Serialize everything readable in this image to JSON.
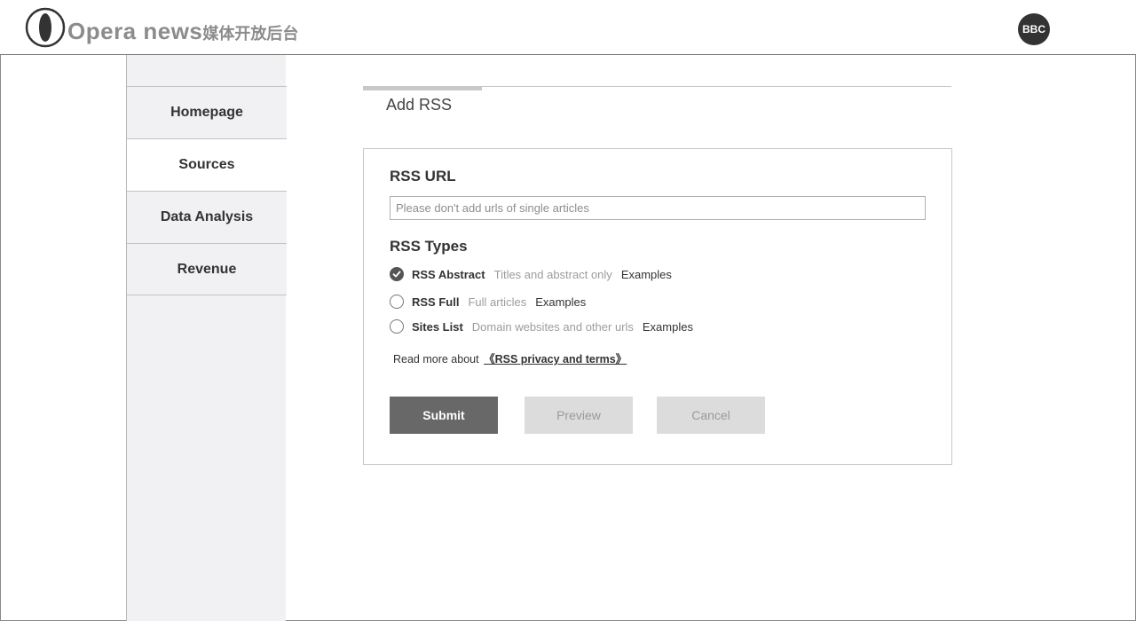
{
  "header": {
    "brand_name": "Opera news",
    "brand_suffix": "媒体开放后台",
    "avatar_label": "BBC"
  },
  "sidebar": {
    "items": [
      {
        "label": "Homepage",
        "active": false
      },
      {
        "label": "Sources",
        "active": true
      },
      {
        "label": "Data Analysis",
        "active": false
      },
      {
        "label": "Revenue",
        "active": false
      }
    ]
  },
  "tabs": [
    {
      "label": "Add RSS",
      "active": true
    }
  ],
  "form": {
    "url_title": "RSS URL",
    "url_placeholder": "Please don't add urls of single articles",
    "url_value": "",
    "types_title": "RSS Types",
    "types": [
      {
        "label": "RSS Abstract",
        "description": "Titles and abstract only",
        "link": "Examples",
        "selected": true
      },
      {
        "label": "RSS Full",
        "description": "Full articles",
        "link": "Examples",
        "selected": false
      },
      {
        "label": "Sites List",
        "description": "Domain websites and other urls",
        "link": "Examples",
        "selected": false
      }
    ],
    "terms_prefix": "Read more about",
    "terms_link": "《RSS privacy and terms》",
    "buttons": {
      "submit": "Submit",
      "preview": "Preview",
      "cancel": "Cancel"
    }
  },
  "colors": {
    "submit_bg": "#686868",
    "disabled_bg": "#dcdcdc",
    "sidebar_bg": "#f1f0f2"
  },
  "icons": [
    "opera-logo-icon",
    "radio-checked-icon"
  ]
}
